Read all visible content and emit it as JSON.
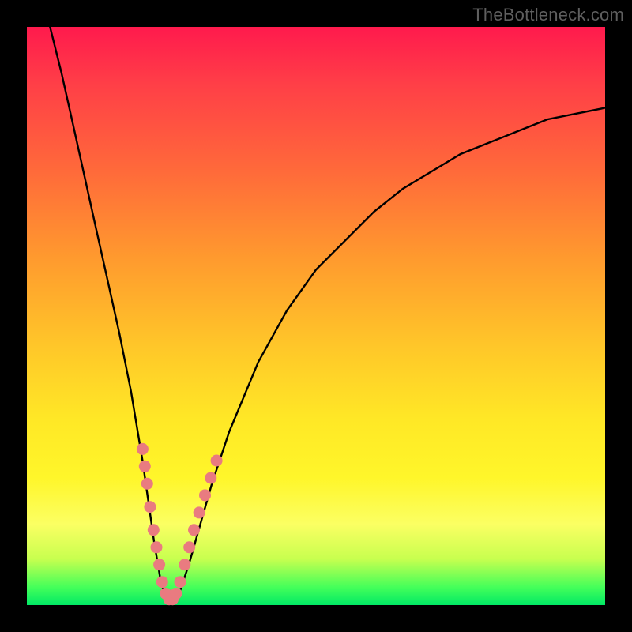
{
  "watermark": "TheBottleneck.com",
  "chart_data": {
    "type": "line",
    "title": "",
    "xlabel": "",
    "ylabel": "",
    "xlim": [
      0,
      100
    ],
    "ylim": [
      0,
      100
    ],
    "grid": false,
    "legend": false,
    "series": [
      {
        "name": "bottleneck-curve",
        "x": [
          4,
          6,
          8,
          10,
          12,
          14,
          16,
          18,
          20,
          21,
          22,
          23,
          24,
          25,
          26,
          28,
          30,
          32,
          35,
          40,
          45,
          50,
          55,
          60,
          65,
          70,
          75,
          80,
          85,
          90,
          95,
          100
        ],
        "y": [
          100,
          92,
          83,
          74,
          65,
          56,
          47,
          37,
          25,
          18,
          11,
          5,
          1,
          0,
          1,
          7,
          14,
          21,
          30,
          42,
          51,
          58,
          63,
          68,
          72,
          75,
          78,
          80,
          82,
          84,
          85,
          86
        ]
      }
    ],
    "markers": {
      "name": "highlighted-points",
      "color": "#e97b80",
      "points": [
        {
          "x": 20.0,
          "y": 27
        },
        {
          "x": 20.4,
          "y": 24
        },
        {
          "x": 20.8,
          "y": 21
        },
        {
          "x": 21.3,
          "y": 17
        },
        {
          "x": 21.9,
          "y": 13
        },
        {
          "x": 22.4,
          "y": 10
        },
        {
          "x": 22.9,
          "y": 7
        },
        {
          "x": 23.4,
          "y": 4
        },
        {
          "x": 24.0,
          "y": 2
        },
        {
          "x": 24.6,
          "y": 1
        },
        {
          "x": 25.2,
          "y": 1
        },
        {
          "x": 25.8,
          "y": 2
        },
        {
          "x": 26.5,
          "y": 4
        },
        {
          "x": 27.3,
          "y": 7
        },
        {
          "x": 28.1,
          "y": 10
        },
        {
          "x": 28.9,
          "y": 13
        },
        {
          "x": 29.8,
          "y": 16
        },
        {
          "x": 30.8,
          "y": 19
        },
        {
          "x": 31.8,
          "y": 22
        },
        {
          "x": 32.8,
          "y": 25
        }
      ]
    },
    "gradient_stops": [
      {
        "pos": 0,
        "color": "#ff1a4d"
      },
      {
        "pos": 25,
        "color": "#ff6a3a"
      },
      {
        "pos": 55,
        "color": "#ffc629"
      },
      {
        "pos": 78,
        "color": "#fff62a"
      },
      {
        "pos": 100,
        "color": "#00e865"
      }
    ]
  }
}
